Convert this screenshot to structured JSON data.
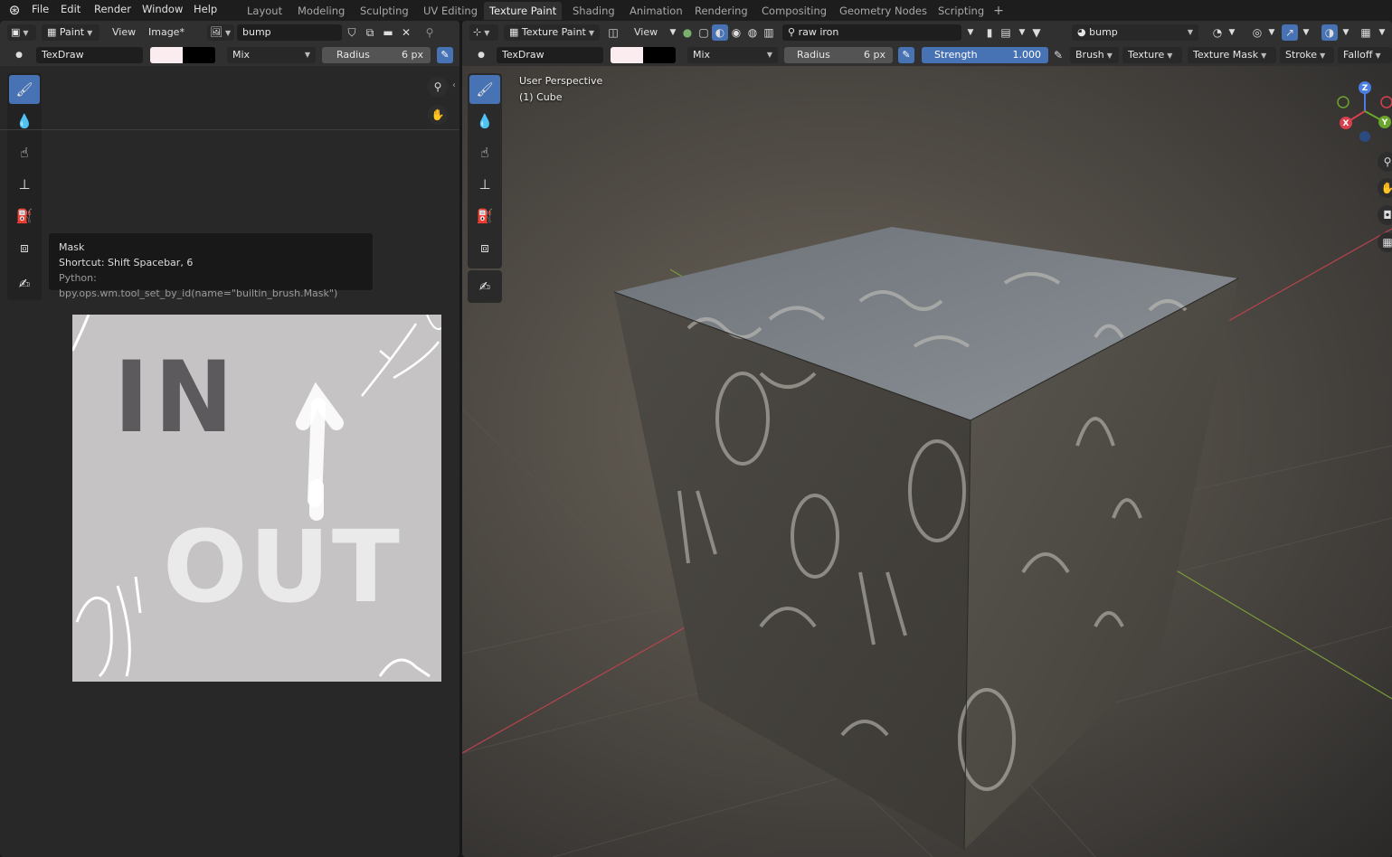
{
  "menu": {
    "items": [
      "File",
      "Edit",
      "Render",
      "Window",
      "Help"
    ]
  },
  "workspaces": {
    "tabs": [
      "Layout",
      "Modeling",
      "Sculpting",
      "UV Editing",
      "Texture Paint",
      "Shading",
      "Animation",
      "Rendering",
      "Compositing",
      "Geometry Nodes",
      "Scripting"
    ],
    "active": "Texture Paint",
    "add_label": "+"
  },
  "image_editor": {
    "mode": "Paint",
    "view": "View",
    "image_menu": "Image*",
    "image_name": "bump",
    "brush_name": "TexDraw",
    "color_primary": "#fbecef",
    "color_secondary": "#000000",
    "blend": "Mix",
    "radius_label": "Radius",
    "radius_value": "6 px",
    "tooltip": {
      "title": "Mask",
      "shortcut": "Shortcut: Shift Spacebar, 6",
      "python": "Python: bpy.ops.wm.tool_set_by_id(name=\"builtin_brush.Mask\")"
    },
    "canvas_text": [
      "IN",
      "OUT"
    ]
  },
  "viewport": {
    "mode": "Texture Paint",
    "view": "View",
    "search_value": "raw iron",
    "slot_name": "bump",
    "brush_name": "TexDraw",
    "color_primary": "#fbecef",
    "color_secondary": "#000000",
    "blend": "Mix",
    "radius_label": "Radius",
    "radius_value": "6 px",
    "strength_label": "Strength",
    "strength_value": "1.000",
    "menus": [
      "Brush",
      "Texture",
      "Texture Mask",
      "Stroke",
      "Falloff"
    ],
    "overlay_line1": "User Perspective",
    "overlay_line2": "(1) Cube",
    "gizmo": {
      "x": "X",
      "y": "Y",
      "z": "Z"
    }
  }
}
